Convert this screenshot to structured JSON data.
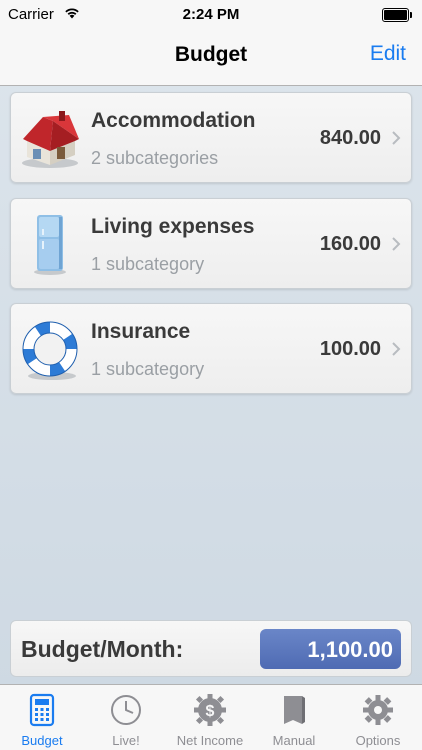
{
  "status": {
    "carrier": "Carrier",
    "time": "2:24 PM"
  },
  "nav": {
    "title": "Budget",
    "edit_label": "Edit"
  },
  "categories": [
    {
      "name": "Accommodation",
      "subtitle": "2 subcategories",
      "amount": "840.00",
      "icon": "house-icon"
    },
    {
      "name": "Living expenses",
      "subtitle": "1 subcategory",
      "amount": "160.00",
      "icon": "fridge-icon"
    },
    {
      "name": "Insurance",
      "subtitle": "1 subcategory",
      "amount": "100.00",
      "icon": "lifebuoy-icon"
    }
  ],
  "total": {
    "label": "Budget/Month:",
    "value": "1,100.00"
  },
  "tabs": [
    {
      "label": "Budget",
      "icon": "calculator-icon",
      "active": true
    },
    {
      "label": "Live!",
      "icon": "clock-icon",
      "active": false
    },
    {
      "label": "Net Income",
      "icon": "dollar-gear-icon",
      "active": false
    },
    {
      "label": "Manual",
      "icon": "book-icon",
      "active": false
    },
    {
      "label": "Options",
      "icon": "gear-icon",
      "active": false
    }
  ],
  "colors": {
    "accent": "#1a7cf0",
    "total_box": "#5a76bd",
    "tab_inactive": "#8e8e93"
  }
}
